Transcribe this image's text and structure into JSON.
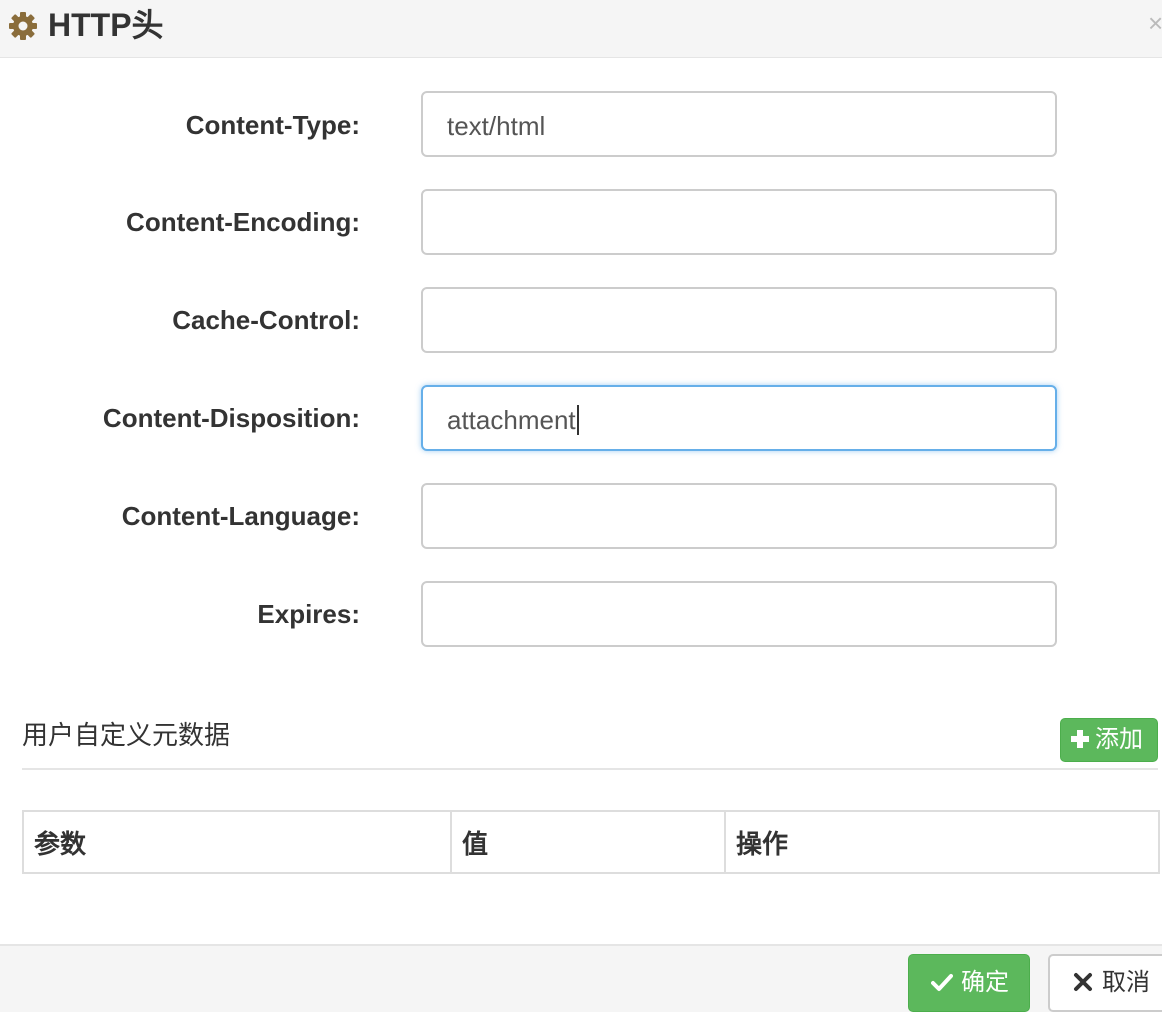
{
  "dialog": {
    "title": "HTTP头",
    "icons": {
      "title_icon": "gear-icon",
      "close_icon": "close-icon"
    },
    "close_glyph": "×"
  },
  "form": {
    "fields": [
      {
        "label": "Content-Type:",
        "value": "text/html",
        "focused": false
      },
      {
        "label": "Content-Encoding:",
        "value": "",
        "focused": false
      },
      {
        "label": "Cache-Control:",
        "value": "",
        "focused": false
      },
      {
        "label": "Content-Disposition:",
        "value": "attachment",
        "focused": true
      },
      {
        "label": "Content-Language:",
        "value": "",
        "focused": false
      },
      {
        "label": "Expires:",
        "value": "",
        "focused": false
      }
    ]
  },
  "metadata": {
    "section_title": "用户自定义元数据",
    "add_label": "添加",
    "add_icon": "plus-icon",
    "table": {
      "headers": [
        "参数",
        "值",
        "操作"
      ]
    }
  },
  "footer": {
    "ok_label": "确定",
    "ok_icon": "check-icon",
    "cancel_label": "取消",
    "cancel_icon": "x-icon"
  },
  "colors": {
    "header_bg": "#f5f5f5",
    "gear": "#8a6d3b",
    "success": "#5cb85c",
    "focus_border": "#66afe9",
    "input_border": "#cccccc"
  }
}
